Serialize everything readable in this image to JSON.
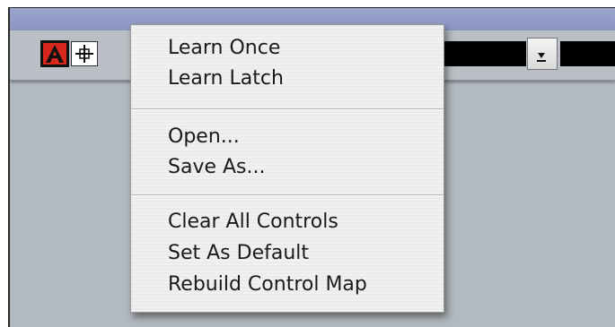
{
  "toolbar": {
    "icons": [
      "automation-a-icon",
      "crosshair-icon",
      "download-icon"
    ]
  },
  "menu": {
    "groups": [
      {
        "items": [
          {
            "label": "Learn Once"
          },
          {
            "label": "Learn Latch"
          }
        ]
      },
      {
        "items": [
          {
            "label": "Open..."
          },
          {
            "label": "Save As..."
          }
        ]
      },
      {
        "items": [
          {
            "label": "Clear All Controls"
          },
          {
            "label": "Set As Default"
          },
          {
            "label": "Rebuild Control Map"
          }
        ]
      }
    ]
  },
  "colors": {
    "window_bg": "#b2b9bf",
    "menu_bg": "#f1f1f1",
    "title_strip": "#9aa5cc",
    "accent_red": "#d8281e"
  }
}
